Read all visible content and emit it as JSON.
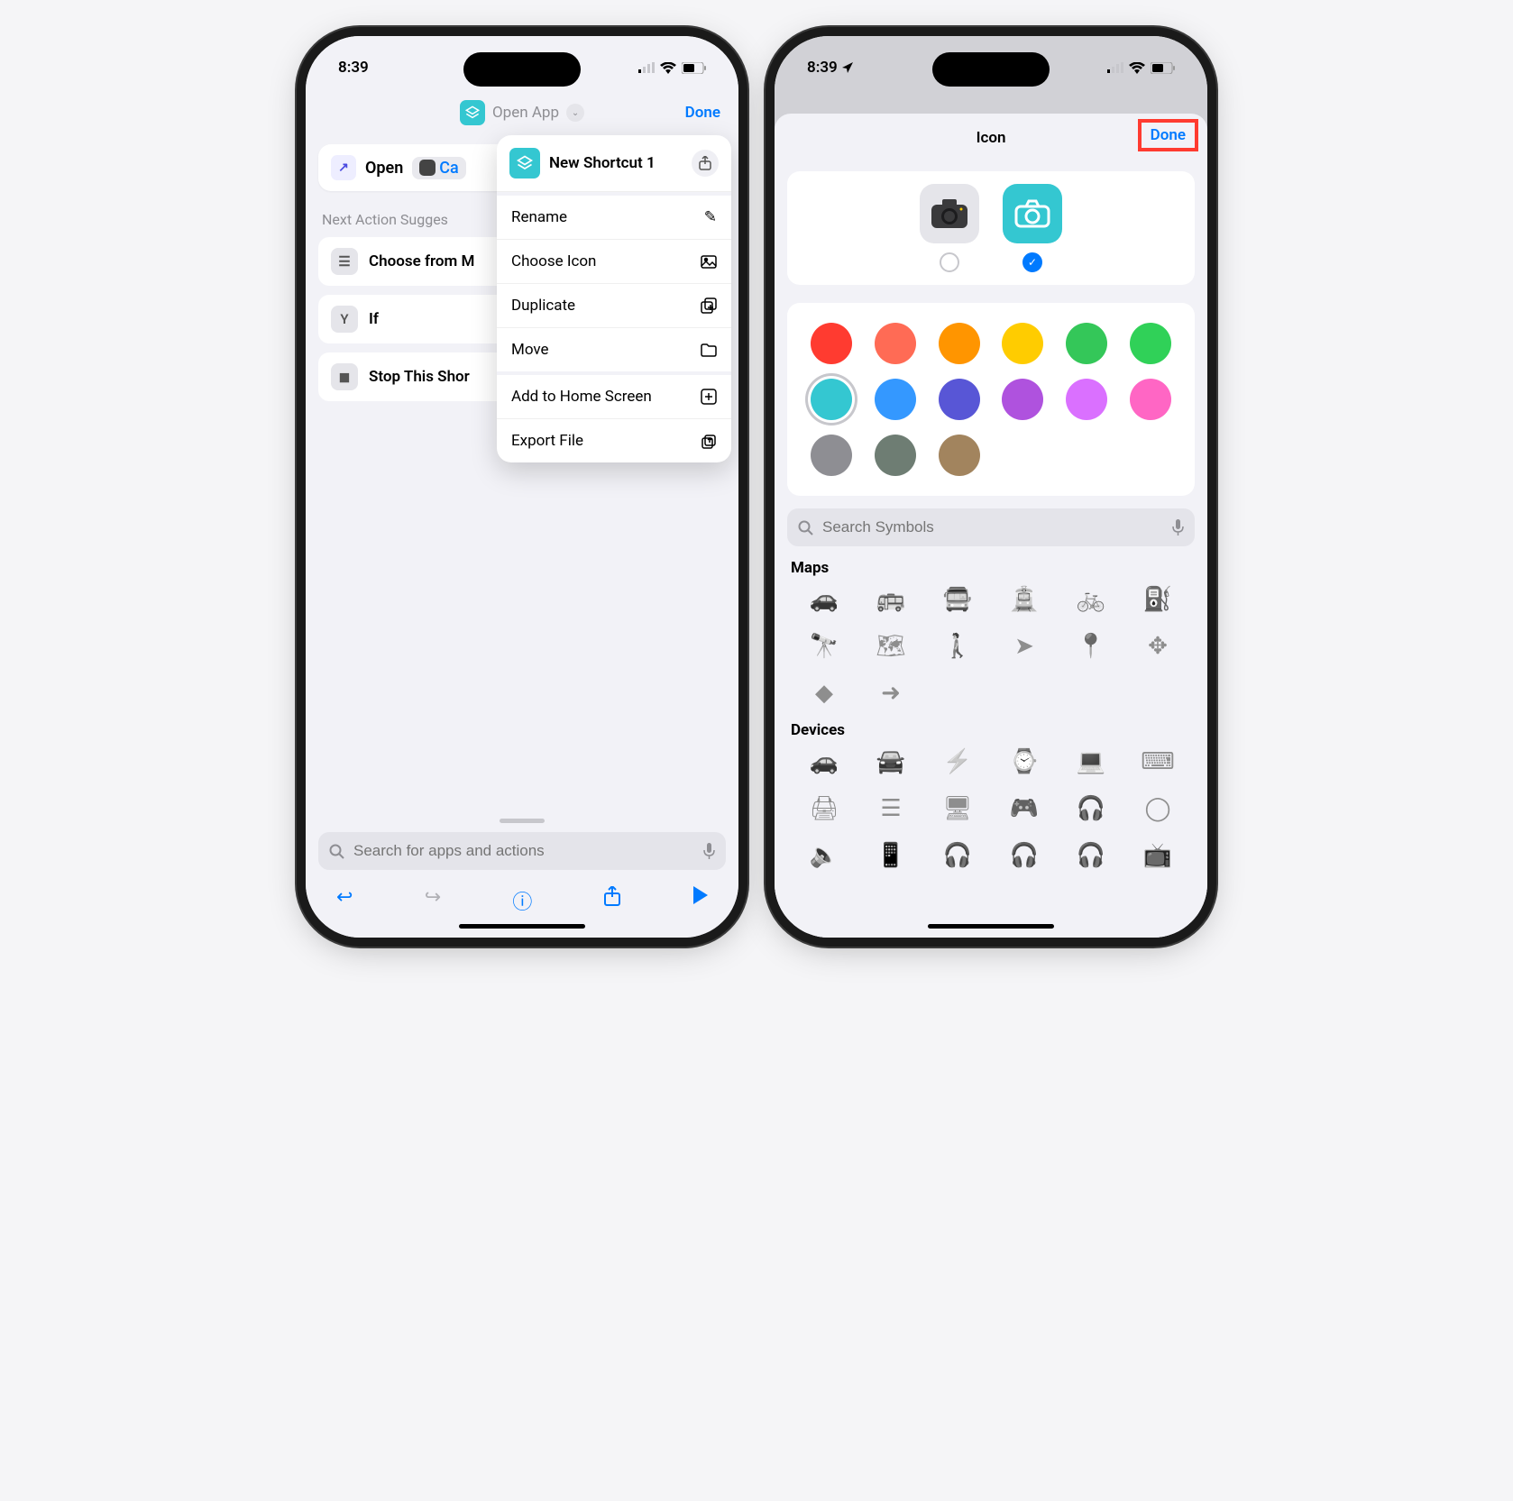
{
  "phone1": {
    "statusbar": {
      "time": "8:39"
    },
    "header": {
      "title": "Open App",
      "done": "Done"
    },
    "action": {
      "verb": "Open",
      "app_chip": "Ca"
    },
    "suggestions_label": "Next Action Sugges",
    "suggestions": [
      {
        "icon": "menu-icon",
        "label": "Choose from M"
      },
      {
        "icon": "branch-icon",
        "label": "If"
      },
      {
        "icon": "stop-icon",
        "label": "Stop This Shor"
      }
    ],
    "popover": {
      "title": "New Shortcut 1",
      "groups": [
        [
          {
            "label": "Rename",
            "icon": "pencil-icon"
          },
          {
            "label": "Choose Icon",
            "icon": "picture-icon"
          },
          {
            "label": "Duplicate",
            "icon": "duplicate-icon"
          },
          {
            "label": "Move",
            "icon": "folder-icon"
          }
        ],
        [
          {
            "label": "Add to Home Screen",
            "icon": "plus-square-icon"
          },
          {
            "label": "Export File",
            "icon": "export-icon"
          }
        ]
      ]
    },
    "search_placeholder": "Search for apps and actions"
  },
  "phone2": {
    "statusbar": {
      "time": "8:39"
    },
    "header": {
      "title": "Icon",
      "done": "Done"
    },
    "icon_choices": [
      {
        "name": "original-app-icon",
        "selected": false
      },
      {
        "name": "colored-glyph-icon",
        "selected": true
      }
    ],
    "colors": [
      {
        "hex": "#ff3b30",
        "selected": false
      },
      {
        "hex": "#ff6b55",
        "selected": false
      },
      {
        "hex": "#ff9500",
        "selected": false
      },
      {
        "hex": "#ffcc00",
        "selected": false
      },
      {
        "hex": "#34c759",
        "selected": false
      },
      {
        "hex": "#30d158",
        "selected": false
      },
      {
        "hex": "#34c7d1",
        "selected": true
      },
      {
        "hex": "#3498ff",
        "selected": false
      },
      {
        "hex": "#5856d6",
        "selected": false
      },
      {
        "hex": "#af52de",
        "selected": false
      },
      {
        "hex": "#da70ff",
        "selected": false
      },
      {
        "hex": "#ff66c4",
        "selected": false
      },
      {
        "hex": "#8e8e93",
        "selected": false
      },
      {
        "hex": "#6e7d73",
        "selected": false
      },
      {
        "hex": "#a2845e",
        "selected": false
      }
    ],
    "search_placeholder": "Search Symbols",
    "symbol_categories": [
      {
        "name": "Maps",
        "symbols": [
          "car",
          "bus",
          "bus-double",
          "tram",
          "bicycle",
          "fuelpump",
          "binoculars",
          "map",
          "walk",
          "location-arrow",
          "pin-radius",
          "move-arrows",
          "turn-sign",
          "arrow-circle"
        ]
      },
      {
        "name": "Devices",
        "symbols": [
          "car",
          "cars",
          "car-charging",
          "applewatch",
          "laptop",
          "keyboard",
          "printer",
          "server",
          "display",
          "gamecontroller",
          "headphones",
          "homepod",
          "speaker",
          "devices",
          "airpods",
          "earpods",
          "airpods-pro",
          "appletv"
        ]
      }
    ]
  }
}
